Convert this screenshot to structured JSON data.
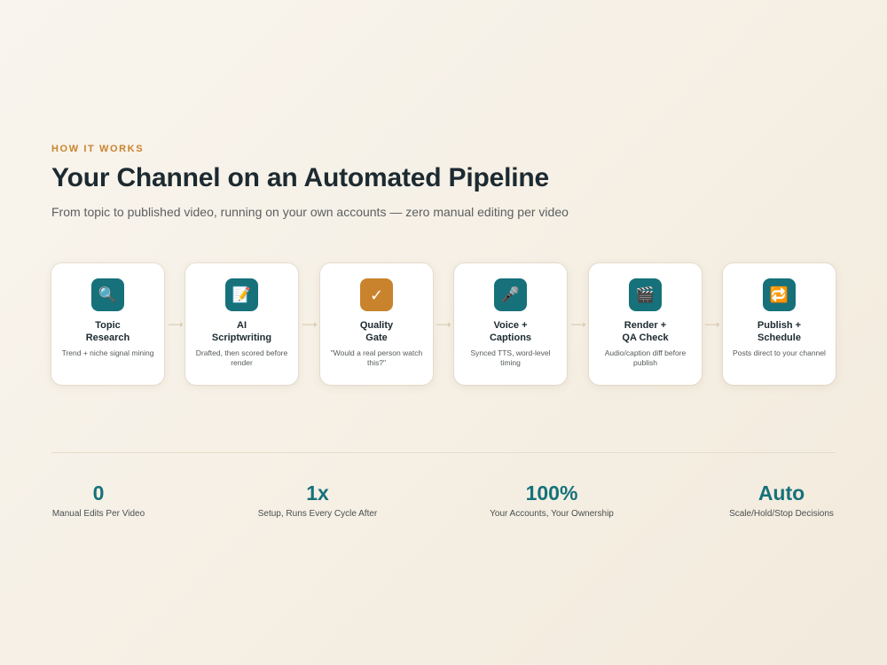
{
  "section": {
    "eyebrow": "HOW IT WORKS",
    "title": "Your Channel on an Automated Pipeline",
    "subtitle": "From topic to published video, running on your own accounts — zero manual editing per video"
  },
  "steps": [
    {
      "title": "Topic\nResearch",
      "description": "Trend + niche signal mining",
      "icon": "🔍",
      "icon_name": "magnifier-icon",
      "icon_color": "#16717a"
    },
    {
      "title": "AI\nScriptwriting",
      "description": "Drafted, then scored before render",
      "icon": "📝",
      "icon_name": "memo-icon",
      "icon_color": "#16717a"
    },
    {
      "title": "Quality\nGate",
      "description": "\"Would a real person watch this?\"",
      "icon": "✓",
      "icon_name": "checkmark-icon",
      "icon_color": "#c9832c"
    },
    {
      "title": "Voice +\nCaptions",
      "description": "Synced TTS, word-level timing",
      "icon": "🎤",
      "icon_name": "microphone-icon",
      "icon_color": "#16717a"
    },
    {
      "title": "Render +\nQA Check",
      "description": "Audio/caption diff before publish",
      "icon": "🎬",
      "icon_name": "clapperboard-icon",
      "icon_color": "#16717a"
    },
    {
      "title": "Publish +\nSchedule",
      "description": "Posts direct to your channel",
      "icon": "🔁",
      "icon_name": "repeat-icon",
      "icon_color": "#16717a"
    }
  ],
  "arrow_glyph": "⟶",
  "stats": [
    {
      "value": "0",
      "label": "Manual Edits Per Video"
    },
    {
      "value": "1x",
      "label": "Setup, Runs Every Cycle After"
    },
    {
      "value": "100%",
      "label": "Your Accounts, Your Ownership"
    },
    {
      "value": "Auto",
      "label": "Scale/Hold/Stop Decisions"
    }
  ],
  "colors": {
    "accent": "#c9832c",
    "teal": "#16717a",
    "background": "#f7f2e9"
  }
}
